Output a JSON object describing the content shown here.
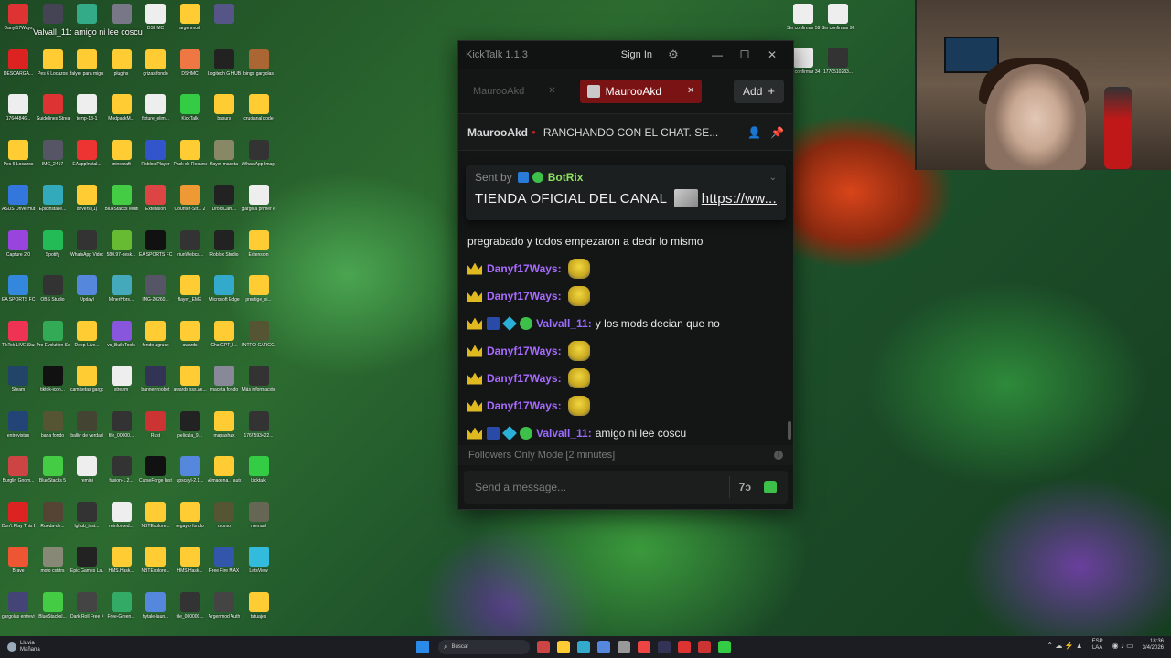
{
  "desktop": {
    "icons": [
      {
        "label": "Danyf17Ways",
        "color": "#d33"
      },
      {
        "label": "",
        "color": "#445"
      },
      {
        "label": "",
        "color": "#3a8"
      },
      {
        "label": "",
        "color": "#778"
      },
      {
        "label": "DSHMC",
        "color": "#eee"
      },
      {
        "label": "argenmod",
        "color": "#fc3"
      },
      {
        "label": "",
        "color": "#558"
      },
      {
        "label": "DESCARGA...",
        "color": "#d22"
      },
      {
        "label": "Pes 6 Locazos",
        "color": "#fc3"
      },
      {
        "label": "falyer para miguel",
        "color": "#fc3"
      },
      {
        "label": "plugins",
        "color": "#fc3"
      },
      {
        "label": "grizas fondo",
        "color": "#fc3"
      },
      {
        "label": "DSHMC",
        "color": "#e74"
      },
      {
        "label": "Logitech G HUB",
        "color": "#222"
      },
      {
        "label": "bingo gargolas",
        "color": "#a63"
      },
      {
        "label": "17644846...",
        "color": "#eee"
      },
      {
        "label": "Guidelines Streams",
        "color": "#d33"
      },
      {
        "label": "temp-13-1",
        "color": "#eee"
      },
      {
        "label": "ModpackM...",
        "color": "#fc3"
      },
      {
        "label": "fixture_elim...",
        "color": "#eee"
      },
      {
        "label": "KickTalk",
        "color": "#3c4"
      },
      {
        "label": "basura",
        "color": "#fc3"
      },
      {
        "label": "crucianal code",
        "color": "#fc3"
      },
      {
        "label": "Pes 6 Locazos",
        "color": "#fc3"
      },
      {
        "label": "IMG_2417",
        "color": "#556"
      },
      {
        "label": "EAappInstal...",
        "color": "#e33"
      },
      {
        "label": "minecraft",
        "color": "#fc3"
      },
      {
        "label": "Roblox Player",
        "color": "#35c"
      },
      {
        "label": "Pack de Recursos",
        "color": "#fc3"
      },
      {
        "label": "flayer maceta",
        "color": "#886"
      },
      {
        "label": "WhatsApp Image 2026",
        "color": "#333"
      },
      {
        "label": "ASUS DriverHub",
        "color": "#37d"
      },
      {
        "label": "Epicinstalle...",
        "color": "#3ab"
      },
      {
        "label": "drivers (1)",
        "color": "#fc3"
      },
      {
        "label": "BlueStacks Multi-Insta...",
        "color": "#4c4"
      },
      {
        "label": "Extension",
        "color": "#d44"
      },
      {
        "label": "Counter-Str... 2",
        "color": "#e93"
      },
      {
        "label": "DroidCam...",
        "color": "#222"
      },
      {
        "label": "gargola primer e...",
        "color": "#eee"
      },
      {
        "label": "Capture 2.0",
        "color": "#94d"
      },
      {
        "label": "Spotify",
        "color": "#2b5"
      },
      {
        "label": "WhatsApp Video 2025",
        "color": "#333"
      },
      {
        "label": "580.97-desk...",
        "color": "#6b3"
      },
      {
        "label": "EA SPORTS FC 26",
        "color": "#111"
      },
      {
        "label": "IriunWebca...",
        "color": "#333"
      },
      {
        "label": "Roblox Studio",
        "color": "#222"
      },
      {
        "label": "Extension",
        "color": "#fc3"
      },
      {
        "label": "EA SPORTS FC 26",
        "color": "#38d"
      },
      {
        "label": "OBS Studio",
        "color": "#333"
      },
      {
        "label": "Updayl",
        "color": "#58d"
      },
      {
        "label": "MinerHors...",
        "color": "#4ab"
      },
      {
        "label": "IMG-20260...",
        "color": "#556"
      },
      {
        "label": "flayer_EME",
        "color": "#fc3"
      },
      {
        "label": "Microsoft Edge",
        "color": "#3ac"
      },
      {
        "label": "prestige_si...",
        "color": "#fc3"
      },
      {
        "label": "TikTok LIVE Studio",
        "color": "#e35"
      },
      {
        "label": "Pro Evolution Soccer 6",
        "color": "#3a5"
      },
      {
        "label": "Deep-Live...",
        "color": "#fc3"
      },
      {
        "label": "vs_BuildTools",
        "color": "#85d"
      },
      {
        "label": "fondo agruck",
        "color": "#fc3"
      },
      {
        "label": "awards",
        "color": "#fc3"
      },
      {
        "label": "ChatGPT_I...",
        "color": "#fc3"
      },
      {
        "label": "INTRO GARGO...",
        "color": "#553"
      },
      {
        "label": "Steam",
        "color": "#246"
      },
      {
        "label": "tiktok-icon...",
        "color": "#111"
      },
      {
        "label": "camisetas gargolas",
        "color": "#fc3"
      },
      {
        "label": "stream",
        "color": "#eee"
      },
      {
        "label": "banner roobet",
        "color": "#335"
      },
      {
        "label": "awards sss.ae...",
        "color": "#fc3"
      },
      {
        "label": "maceta fondo",
        "color": "#889"
      },
      {
        "label": "Más información",
        "color": "#333"
      },
      {
        "label": "entrevistas",
        "color": "#247"
      },
      {
        "label": "bana fondo",
        "color": "#553"
      },
      {
        "label": "ballin de verdad",
        "color": "#443"
      },
      {
        "label": "file_00000...",
        "color": "#333"
      },
      {
        "label": "Rust",
        "color": "#c33"
      },
      {
        "label": "pelicula_9...",
        "color": "#222"
      },
      {
        "label": "mapashax",
        "color": "#fc3"
      },
      {
        "label": "1767593422...",
        "color": "#333"
      },
      {
        "label": "Burglin Gnom...",
        "color": "#c44"
      },
      {
        "label": "BlueStacks 5",
        "color": "#4c4"
      },
      {
        "label": "remini",
        "color": "#eee"
      },
      {
        "label": "fusion-1.2...",
        "color": "#333"
      },
      {
        "label": "CurseForge Installer",
        "color": "#111"
      },
      {
        "label": "upscayl-2.1...",
        "color": "#58d"
      },
      {
        "label": "Almacena... automátic...",
        "color": "#fc3"
      },
      {
        "label": "kicktalk",
        "color": "#3c4"
      },
      {
        "label": "Don't Play This Demo",
        "color": "#d22"
      },
      {
        "label": "Rueda-de...",
        "color": "#543"
      },
      {
        "label": "lghub_inst...",
        "color": "#333"
      },
      {
        "label": "reinforced...",
        "color": "#eee"
      },
      {
        "label": "NBTExplore...",
        "color": "#fc3"
      },
      {
        "label": "regaylo fondo",
        "color": "#fc3"
      },
      {
        "label": "momo",
        "color": "#553"
      },
      {
        "label": "memuel",
        "color": "#665"
      },
      {
        "label": "Brave",
        "color": "#e53"
      },
      {
        "label": "mofo cstrtrs",
        "color": "#887"
      },
      {
        "label": "Epic Games Launcher",
        "color": "#222"
      },
      {
        "label": "HMS.Hask...",
        "color": "#fc3"
      },
      {
        "label": "NBTExplore...",
        "color": "#fc3"
      },
      {
        "label": "HMS.Hask...",
        "color": "#fc3"
      },
      {
        "label": "Free Fire MAX",
        "color": "#35a"
      },
      {
        "label": "LetsView",
        "color": "#3bd"
      },
      {
        "label": "gargolas entrevistas",
        "color": "#447"
      },
      {
        "label": "BlueStacksI...",
        "color": "#4c4"
      },
      {
        "label": "Dark Roll Free Kick...",
        "color": "#444"
      },
      {
        "label": "Free-Green...",
        "color": "#3a6"
      },
      {
        "label": "hytale-laun...",
        "color": "#58d"
      },
      {
        "label": "file_000000...",
        "color": "#333"
      },
      {
        "label": "Argenmod Auth",
        "color": "#444"
      },
      {
        "label": "tatuajes",
        "color": "#fc3"
      }
    ],
    "overlay_text": "Valvall_11: amigo ni lee coscu",
    "right_files": [
      {
        "label": "Sin confirmar 598673.crd...",
        "color": "#eee"
      },
      {
        "label": "Sin confirmar 962937.crd...",
        "color": "#eee"
      },
      {
        "label": "Sin confirmar 34133.crd...",
        "color": "#eee"
      },
      {
        "label": "1770510283...",
        "color": "#333"
      }
    ]
  },
  "window": {
    "title": "KickTalk 1.1.3",
    "sign_in": "Sign In",
    "settings_icon": "gear-icon",
    "controls": [
      "—",
      "☐",
      "✕"
    ]
  },
  "tabs": {
    "items": [
      {
        "label": "MaurooAkd",
        "active": false
      },
      {
        "label": "MaurooAkd",
        "active": true
      }
    ],
    "add_label": "Add"
  },
  "channel": {
    "name": "MaurooAkd",
    "stream_title": "RANCHANDO CON EL CHAT. SE..."
  },
  "pinned": {
    "sent_by": "Sent by",
    "bot_name": "BotRix",
    "message": "TIENDA OFICIAL DEL CANAL",
    "link": "https://ww..."
  },
  "messages": [
    {
      "type": "text",
      "user": "",
      "text": "pregrabado y todos empezaron a decir lo mismo"
    },
    {
      "type": "emote",
      "user": "Danyf17Ways:"
    },
    {
      "type": "emote",
      "user": "Danyf17Ways:"
    },
    {
      "type": "text",
      "user": "Valvall_11:",
      "text": "y los mods decian que no"
    },
    {
      "type": "emote",
      "user": "Danyf17Ways:"
    },
    {
      "type": "emote",
      "user": "Danyf17Ways:"
    },
    {
      "type": "emote",
      "user": "Danyf17Ways:"
    },
    {
      "type": "text",
      "user": "Valvall_11:",
      "text": "amigo ni lee coscu"
    }
  ],
  "followers_mode": "Followers Only Mode [2 minutes]",
  "composer": {
    "placeholder": "Send a message..."
  },
  "taskbar": {
    "weather_line1": "Lluvia",
    "weather_line2": "Mañana",
    "search_placeholder": "Buscar",
    "lang_line1": "ESP",
    "lang_line2": "LAA",
    "time": "18:36",
    "date": "3/4/2026",
    "apps": [
      "#c44",
      "#fc3",
      "#3ac",
      "#58d",
      "#999",
      "#e44",
      "#335",
      "#d33",
      "#c33",
      "#3c4"
    ]
  },
  "colors": {
    "accent_tab": "#7a1414",
    "kick_green": "#3cc04a",
    "username_purple": "#a86bff",
    "bot_green": "#8ee060"
  }
}
